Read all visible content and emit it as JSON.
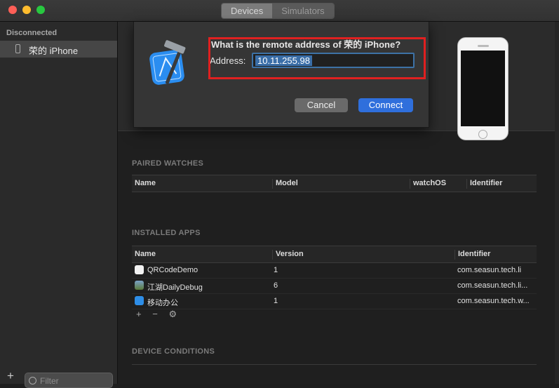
{
  "segmented": [
    "Devices",
    "Simulators"
  ],
  "sidebar": {
    "section": "Disconnected",
    "device": "荣的 iPhone",
    "filter_placeholder": "Filter",
    "add_label": "+"
  },
  "dialog": {
    "question": "What is the remote address of 荣的 iPhone?",
    "address_label": "Address:",
    "address_value": "10.11.255.98",
    "cancel": "Cancel",
    "connect": "Connect"
  },
  "paired_watches": {
    "title": "PAIRED WATCHES",
    "columns": [
      "Name",
      "Model",
      "watchOS",
      "Identifier"
    ]
  },
  "installed_apps": {
    "title": "INSTALLED APPS",
    "columns": [
      "Name",
      "Version",
      "Identifier"
    ],
    "rows": [
      {
        "name": "QRCodeDemo",
        "version": "1",
        "identifier": "com.seasun.tech.li"
      },
      {
        "name": "江湖DailyDebug",
        "version": "6",
        "identifier": "com.seasun.tech.li..."
      },
      {
        "name": "移动办公",
        "version": "1",
        "identifier": "com.seasun.tech.w..."
      }
    ],
    "tools": [
      "+",
      "−",
      "⚙"
    ]
  },
  "device_conditions": {
    "title": "DEVICE CONDITIONS"
  },
  "colors": {
    "accent": "#2f6fdc",
    "highlight": "#e02020",
    "selection": "#3a6ea8"
  }
}
